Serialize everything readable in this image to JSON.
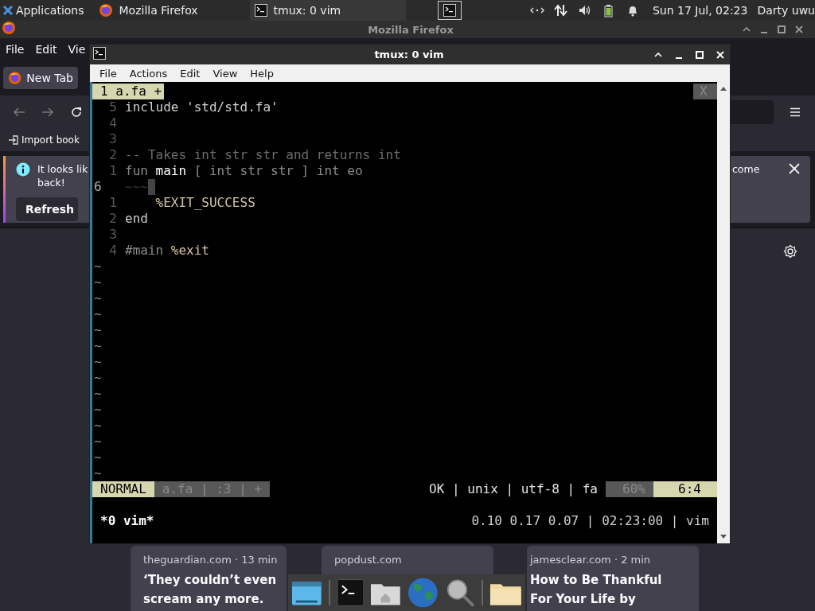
{
  "panel": {
    "apps_label": "Applications",
    "tasks": [
      {
        "title": "Mozilla Firefox",
        "kind": "firefox",
        "selected": false
      },
      {
        "title": "tmux: 0 vim",
        "kind": "terminal",
        "selected": true
      }
    ],
    "clock": "Sun 17 Jul, 02:23",
    "user": "Darty uwu"
  },
  "firefox": {
    "title": "Mozilla Firefox",
    "menu": [
      "File",
      "Edit",
      "Vie"
    ],
    "tab": "New Tab",
    "bookmark": "Import book",
    "notification": {
      "lines": [
        "It looks lik",
        "back!"
      ],
      "button": "Refresh",
      "right_text": "come"
    },
    "cards": [
      {
        "source": "theguardian.com · 13 min",
        "headline": [
          "‘They couldn’t even",
          "scream any more."
        ]
      },
      {
        "source": "popdust.com"
      },
      {
        "source": "jamesclear.com · 2 min",
        "headline": [
          "How to Be Thankful",
          "For Your Life by"
        ]
      }
    ]
  },
  "terminal": {
    "title": "tmux: 0 vim",
    "menu": [
      "File",
      "Actions",
      "Edit",
      "View",
      "Help"
    ],
    "tabline": {
      "label": "1 a.fa +",
      "close": "X"
    },
    "lines": [
      {
        "num": "5",
        "current": false,
        "cursor": false,
        "segments": [
          {
            "kind": "plain",
            "text": "include 'std/std.fa'"
          }
        ]
      },
      {
        "num": "4",
        "current": false,
        "cursor": false
      },
      {
        "num": "3",
        "current": false,
        "cursor": false
      },
      {
        "num": "2",
        "current": false,
        "cursor": false,
        "segments": [
          {
            "kind": "comment",
            "text": "-- Takes int str str and returns int"
          }
        ]
      },
      {
        "num": "1",
        "current": false,
        "cursor": false,
        "segments": [
          {
            "kind": "dim",
            "text": "fun "
          },
          {
            "kind": "bright",
            "text": "main"
          },
          {
            "kind": "dim",
            "text": " [ int str str ] int eo"
          }
        ]
      },
      {
        "num": "6",
        "current": true,
        "cursor": true,
        "segments": [
          {
            "kind": "faint",
            "text": "~~~"
          }
        ]
      },
      {
        "num": "1",
        "current": false,
        "cursor": false,
        "segments": [
          {
            "kind": "constant",
            "text": "    %EXIT_SUCCESS"
          }
        ]
      },
      {
        "num": "2",
        "current": false,
        "cursor": false,
        "segments": [
          {
            "kind": "plain",
            "text": "end"
          }
        ]
      },
      {
        "num": "3",
        "current": false,
        "cursor": false
      },
      {
        "num": "4",
        "current": false,
        "cursor": false,
        "segments": [
          {
            "kind": "dim",
            "text": "#main "
          },
          {
            "kind": "constant",
            "text": "%exit"
          }
        ]
      }
    ],
    "filler": [
      "~",
      "~",
      "~",
      "~",
      "~",
      "~",
      "~",
      "~",
      "~",
      "~",
      "~",
      "~",
      "~",
      "~"
    ],
    "statusline": {
      "mode": "NORMAL",
      "file_info": "a.fa | :3 | +",
      "file_format": "OK | unix | utf-8 | fa",
      "percent": "60%",
      "position": "6:4"
    },
    "tmux": {
      "window": "*0 vim*",
      "right": "0.10 0.17 0.07 | 02:23:00 | vim"
    }
  }
}
